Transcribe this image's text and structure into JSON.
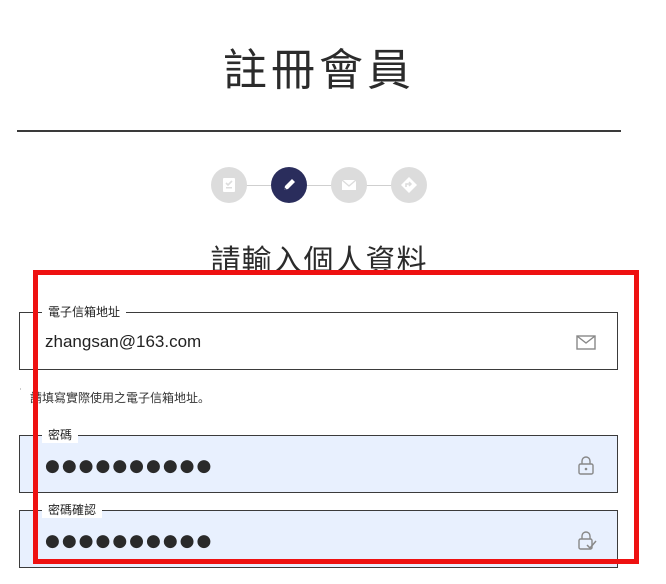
{
  "page": {
    "title": "註冊會員",
    "subtitle": "請輸入個人資料"
  },
  "stepper": {
    "steps": [
      {
        "icon": "checklist-icon",
        "state": "done"
      },
      {
        "icon": "pencil-icon",
        "state": "active"
      },
      {
        "icon": "envelope-icon",
        "state": "pending"
      },
      {
        "icon": "diamond-arrow-icon",
        "state": "pending"
      }
    ],
    "active_color": "#2a2d5c",
    "inactive_color": "#dcdcdc"
  },
  "form": {
    "email": {
      "label": "電子信箱地址",
      "value": "zhangsan@163.com",
      "icon": "envelope-icon"
    },
    "email_hint": "請填寫實際使用之電子信箱地址。",
    "password": {
      "label": "密碼",
      "value": "●●●●●●●●●●",
      "icon": "lock-icon"
    },
    "password_confirm": {
      "label": "密碼確認",
      "value": "●●●●●●●●●●",
      "icon": "lock-check-icon"
    }
  },
  "colors": {
    "highlight": "#ee1111",
    "autofill_bg": "#e8f0fe"
  }
}
